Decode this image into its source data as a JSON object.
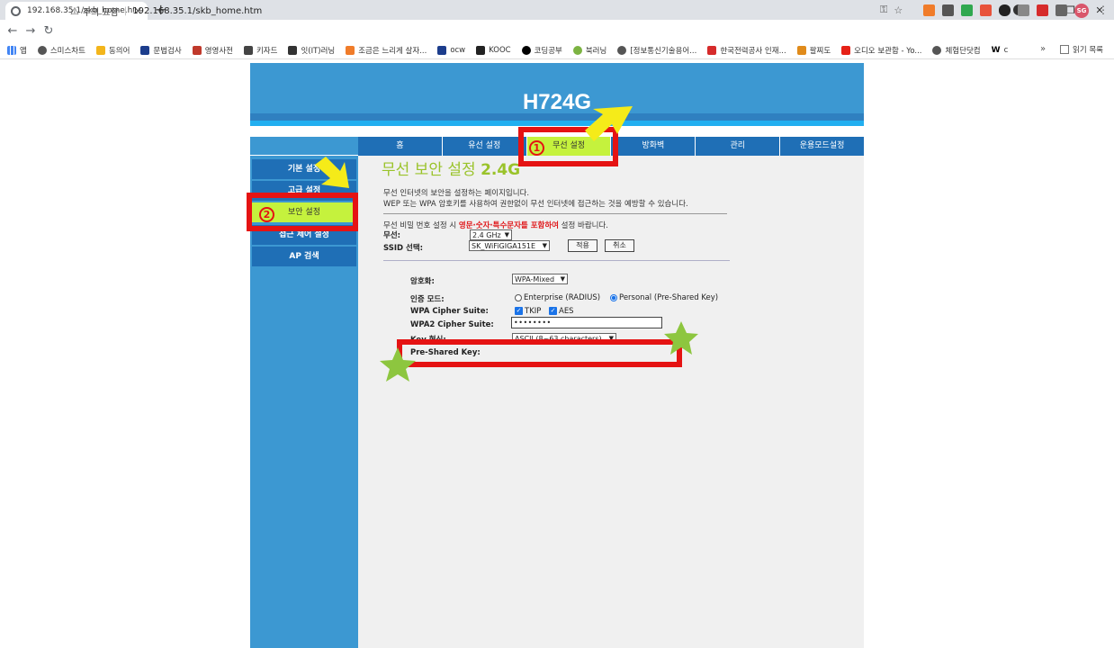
{
  "browser": {
    "tab_title": "192.168.35.1/skb_home.htm",
    "tab_close": "✕",
    "new_tab": "+",
    "security_label": "주의 요함",
    "url": "192.168.35.1/skb_home.htm",
    "bookmarks": [
      "앱",
      "스미스차트",
      "동의어",
      "문법검사",
      "영영사전",
      "키자드",
      "잇(IT)러닝",
      "조금은 느리게 살자...",
      "ocw",
      "KOOC",
      "코딩공부",
      "북러닝",
      "[정보통신기술용어...",
      "한국전력공사 인재...",
      "팔찌도",
      "오디오 보관함 - Yo...",
      "체험단닷컴",
      "c"
    ],
    "bookmarks_more": "»",
    "reading_list": "읽기 목록",
    "profile_initials": "SG",
    "colors": {
      "tabstrip": "#dee1e6",
      "avatar": "#d9566b"
    }
  },
  "router": {
    "model": "H724G",
    "top_nav": [
      "홈",
      "유선 설정",
      "무선 설정",
      "방화벽",
      "관리",
      "운용모드설정"
    ],
    "left_nav": [
      "기본 설정",
      "고급 설정",
      "보안 설정",
      "접근 제어 설정",
      "AP 검색"
    ],
    "page_title_prefix": "무선 보안 설정",
    "page_title_suffix": "2.4G",
    "desc_line1": "무선 인터넷의 보안을 설정하는 페이지입니다.",
    "desc_line2": "WEP 또는 WPA 암호키를 사용하여 권한없이 무선 인터넷에 접근하는 것을 예방할 수 있습니다.",
    "note_before": "무선 비밀 번호 설정 시 ",
    "note_red": "영문·숫자·특수문자를 포함하여",
    "note_after": " 설정 바랍니다.",
    "band_label": "무선:",
    "band_value": "2.4 GHz",
    "ssid_label": "SSID 선택:",
    "ssid_value": "SK_WiFiGIGA151E",
    "apply_label": "적용",
    "cancel_label": "취소",
    "encryption_label": "암호화:",
    "encryption_value": "WPA-Mixed",
    "auth_label": "인증 모드:",
    "auth_enterprise": "Enterprise (RADIUS)",
    "auth_personal": "Personal (Pre-Shared Key)",
    "wpa_cipher_label": "WPA Cipher Suite:",
    "wpa2_cipher_label": "WPA2 Cipher Suite:",
    "cipher_tkip": "TKIP",
    "cipher_aes": "AES",
    "key_format_label": "Key 형식:",
    "key_format_value": "ASCII (8~63 characters)",
    "psk_label": "Pre-Shared Key:",
    "psk_value": "••••••••",
    "colors": {
      "banner": "#3c98d2",
      "nav_dark": "#1f6fb6",
      "active": "#c5f23d",
      "title": "#9ac32a",
      "warning": "#e0181b"
    }
  },
  "annotations": {
    "step1": "1",
    "step2": "2",
    "colors": {
      "box": "#e51313",
      "arrow": "#f5eb19",
      "star": "#8dc63f"
    }
  }
}
